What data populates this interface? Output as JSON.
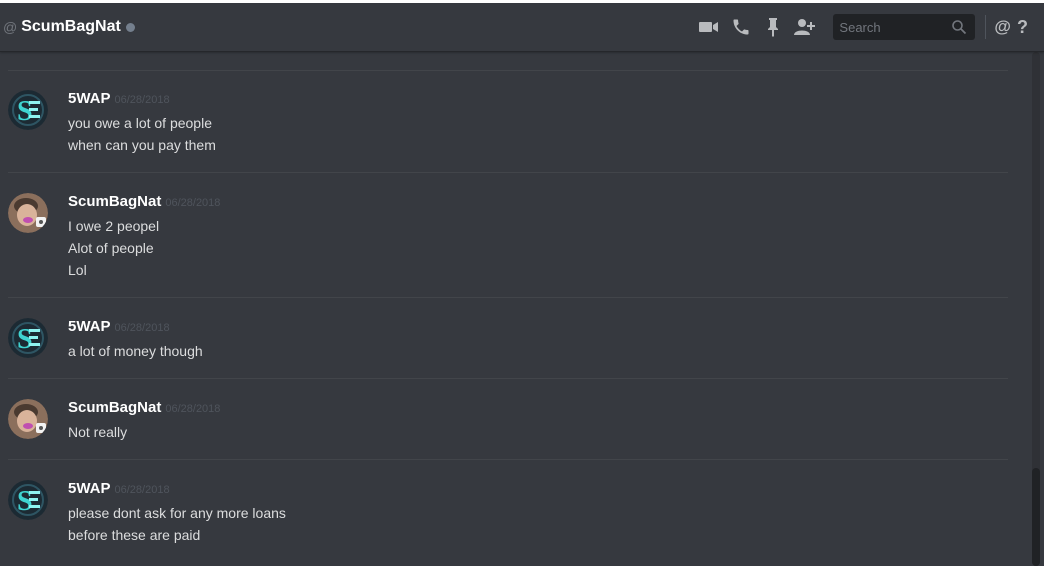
{
  "header": {
    "at_symbol": "@",
    "channel_name": "ScumBagNat",
    "search_placeholder": "Search",
    "mention_symbol": "@",
    "help_symbol": "?"
  },
  "messages": [
    {
      "author": "5WAP",
      "timestamp": "06/28/2018",
      "avatar": "swap-logo-avatar",
      "lines": [
        "you owe a lot of people",
        "when can you pay them"
      ]
    },
    {
      "author": "ScumBagNat",
      "timestamp": "06/28/2018",
      "avatar": "scumbagnat-photo-avatar",
      "lines": [
        "I owe 2 peopel",
        "Alot of people",
        "Lol"
      ]
    },
    {
      "author": "5WAP",
      "timestamp": "06/28/2018",
      "avatar": "swap-logo-avatar",
      "lines": [
        "a lot of money though"
      ]
    },
    {
      "author": "ScumBagNat",
      "timestamp": "06/28/2018",
      "avatar": "scumbagnat-photo-avatar",
      "lines": [
        "Not really"
      ]
    },
    {
      "author": "5WAP",
      "timestamp": "06/28/2018",
      "avatar": "swap-logo-avatar",
      "lines": [
        "please dont ask for any more loans",
        "before these are paid"
      ]
    }
  ],
  "colors": {
    "background": "#36393f",
    "username": "#ffffff",
    "message_text": "#dcddde",
    "timestamp": "#4f545c",
    "status_offline": "#747f8d"
  },
  "icons": [
    "video-call-icon",
    "voice-call-icon",
    "pin-icon",
    "add-friend-icon",
    "search-icon",
    "mention-icon",
    "help-icon"
  ]
}
